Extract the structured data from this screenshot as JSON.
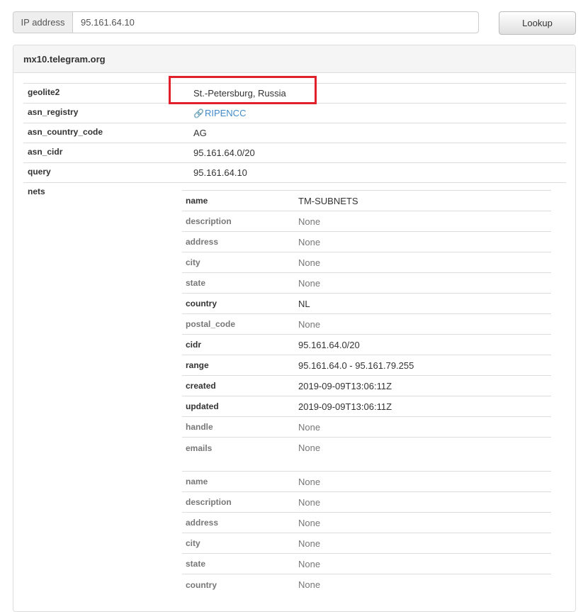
{
  "search": {
    "addon_label": "IP address",
    "value": "95.161.64.10",
    "button_label": "Lookup"
  },
  "panel": {
    "title": "mx10.telegram.org"
  },
  "fields": {
    "geolite2_label": "geolite2",
    "geolite2_value": "St.-Petersburg, Russia",
    "asn_registry_label": "asn_registry",
    "asn_registry_icon": "link-icon",
    "asn_registry_value": "RIPENCC",
    "asn_country_code_label": "asn_country_code",
    "asn_country_code_value": "AG",
    "asn_cidr_label": "asn_cidr",
    "asn_cidr_value": "95.161.64.0/20",
    "query_label": "query",
    "query_value": "95.161.64.10",
    "nets_label": "nets"
  },
  "highlight_color": "#e0202a",
  "link_color": "#428bca",
  "nets": [
    {
      "rows": [
        {
          "label": "name",
          "value": "TM-SUBNETS",
          "strong": true
        },
        {
          "label": "description",
          "value": "None",
          "strong": false
        },
        {
          "label": "address",
          "value": "None",
          "strong": false
        },
        {
          "label": "city",
          "value": "None",
          "strong": false
        },
        {
          "label": "state",
          "value": "None",
          "strong": false
        },
        {
          "label": "country",
          "value": "NL",
          "strong": true
        },
        {
          "label": "postal_code",
          "value": "None",
          "strong": false
        },
        {
          "label": "cidr",
          "value": "95.161.64.0/20",
          "strong": true
        },
        {
          "label": "range",
          "value": "95.161.64.0 - 95.161.79.255",
          "strong": true
        },
        {
          "label": "created",
          "value": "2019-09-09T13:06:11Z",
          "strong": true
        },
        {
          "label": "updated",
          "value": "2019-09-09T13:06:11Z",
          "strong": true
        },
        {
          "label": "handle",
          "value": "None",
          "strong": false
        },
        {
          "label": "emails",
          "value": "None",
          "strong": false
        }
      ]
    },
    {
      "rows": [
        {
          "label": "name",
          "value": "None",
          "strong": false
        },
        {
          "label": "description",
          "value": "None",
          "strong": false
        },
        {
          "label": "address",
          "value": "None",
          "strong": false
        },
        {
          "label": "city",
          "value": "None",
          "strong": false
        },
        {
          "label": "state",
          "value": "None",
          "strong": false
        },
        {
          "label": "country",
          "value": "None",
          "strong": false
        }
      ]
    }
  ]
}
